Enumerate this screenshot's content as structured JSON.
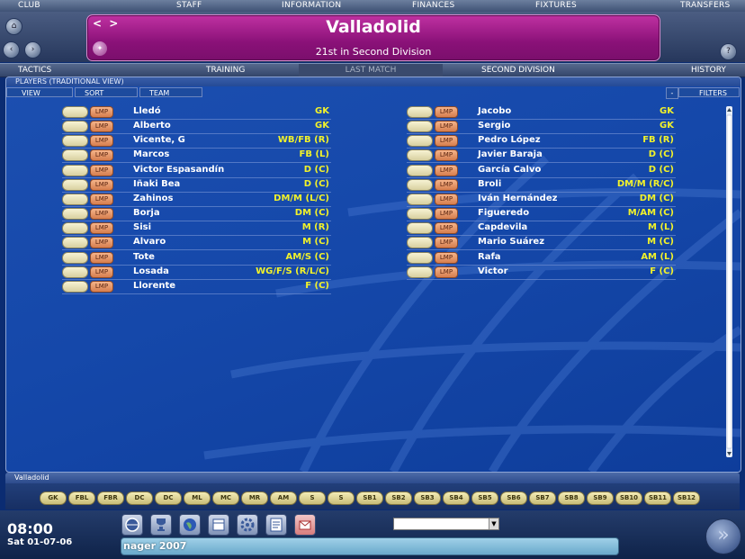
{
  "top_nav": [
    "CLUB",
    "STAFF",
    "INFORMATION",
    "FINANCES",
    "FIXTURES",
    "TRANSFERS"
  ],
  "header": {
    "club_name": "Valladolid",
    "league_position": "21st in Second Division",
    "nav_arrows": "< >"
  },
  "sub_tabs": [
    "TACTICS",
    "TRAINING",
    "LAST MATCH",
    "SECOND DIVISION",
    "HISTORY"
  ],
  "active_sub_tab": "LAST MATCH",
  "panel": {
    "title": "PLAYERS (TRADITIONAL VIEW)",
    "view_label": "VIEW",
    "sort_label": "SORT",
    "team_label": "TEAM",
    "filters_label": "FILTERS",
    "filters_prefix": "-"
  },
  "lmp_label": "LMP",
  "players_left": [
    {
      "name": "Lledó",
      "pos": "GK"
    },
    {
      "name": "Alberto",
      "pos": "GK"
    },
    {
      "name": "Vicente, G",
      "pos": "WB/FB (R)"
    },
    {
      "name": "Marcos",
      "pos": "FB (L)"
    },
    {
      "name": "Victor Espasandín",
      "pos": "D (C)"
    },
    {
      "name": "Iñaki Bea",
      "pos": "D (C)"
    },
    {
      "name": "Zahinos",
      "pos": "DM/M (L/C)"
    },
    {
      "name": "Borja",
      "pos": "DM (C)"
    },
    {
      "name": "Sisi",
      "pos": "M (R)"
    },
    {
      "name": "Alvaro",
      "pos": "M (C)"
    },
    {
      "name": "Tote",
      "pos": "AM/S (C)"
    },
    {
      "name": "Losada",
      "pos": "WG/F/S (R/L/C)"
    },
    {
      "name": "Llorente",
      "pos": "F (C)"
    }
  ],
  "players_right": [
    {
      "name": "Jacobo",
      "pos": "GK"
    },
    {
      "name": "Sergio",
      "pos": "GK"
    },
    {
      "name": "Pedro López",
      "pos": "FB (R)"
    },
    {
      "name": "Javier Baraja",
      "pos": "D (C)"
    },
    {
      "name": "García Calvo",
      "pos": "D (C)"
    },
    {
      "name": "Broli",
      "pos": "DM/M (R/C)"
    },
    {
      "name": "Iván Hernández",
      "pos": "DM (C)"
    },
    {
      "name": "Figueredo",
      "pos": "M/AM (C)"
    },
    {
      "name": "Capdevila",
      "pos": "M (L)"
    },
    {
      "name": "Mario Suárez",
      "pos": "M (C)"
    },
    {
      "name": "Rafa",
      "pos": "AM (L)"
    },
    {
      "name": "Victor",
      "pos": "F (C)"
    }
  ],
  "formation_bar": {
    "team": "Valladolid",
    "slots": [
      "GK",
      "FBL",
      "FBR",
      "DC",
      "DC",
      "ML",
      "MC",
      "MR",
      "AM",
      "S",
      "S",
      "SB1",
      "SB2",
      "SB3",
      "SB4",
      "SB5",
      "SB6",
      "SB7",
      "SB8",
      "SB9",
      "SB10",
      "SB11",
      "SB12"
    ]
  },
  "status": {
    "time": "08:00",
    "date": "Sat 01-07-06",
    "ticker": "nager 2007",
    "dropdown_value": ""
  },
  "quick_icons": [
    "ball-icon",
    "trophy-icon",
    "globe-icon",
    "calendar-icon",
    "gear-icon",
    "notepad-icon",
    "inbox-icon"
  ],
  "colors": {
    "title_box": "#8a1178",
    "panel_bg": "#1548aa",
    "position_text": "#f2f22a"
  }
}
